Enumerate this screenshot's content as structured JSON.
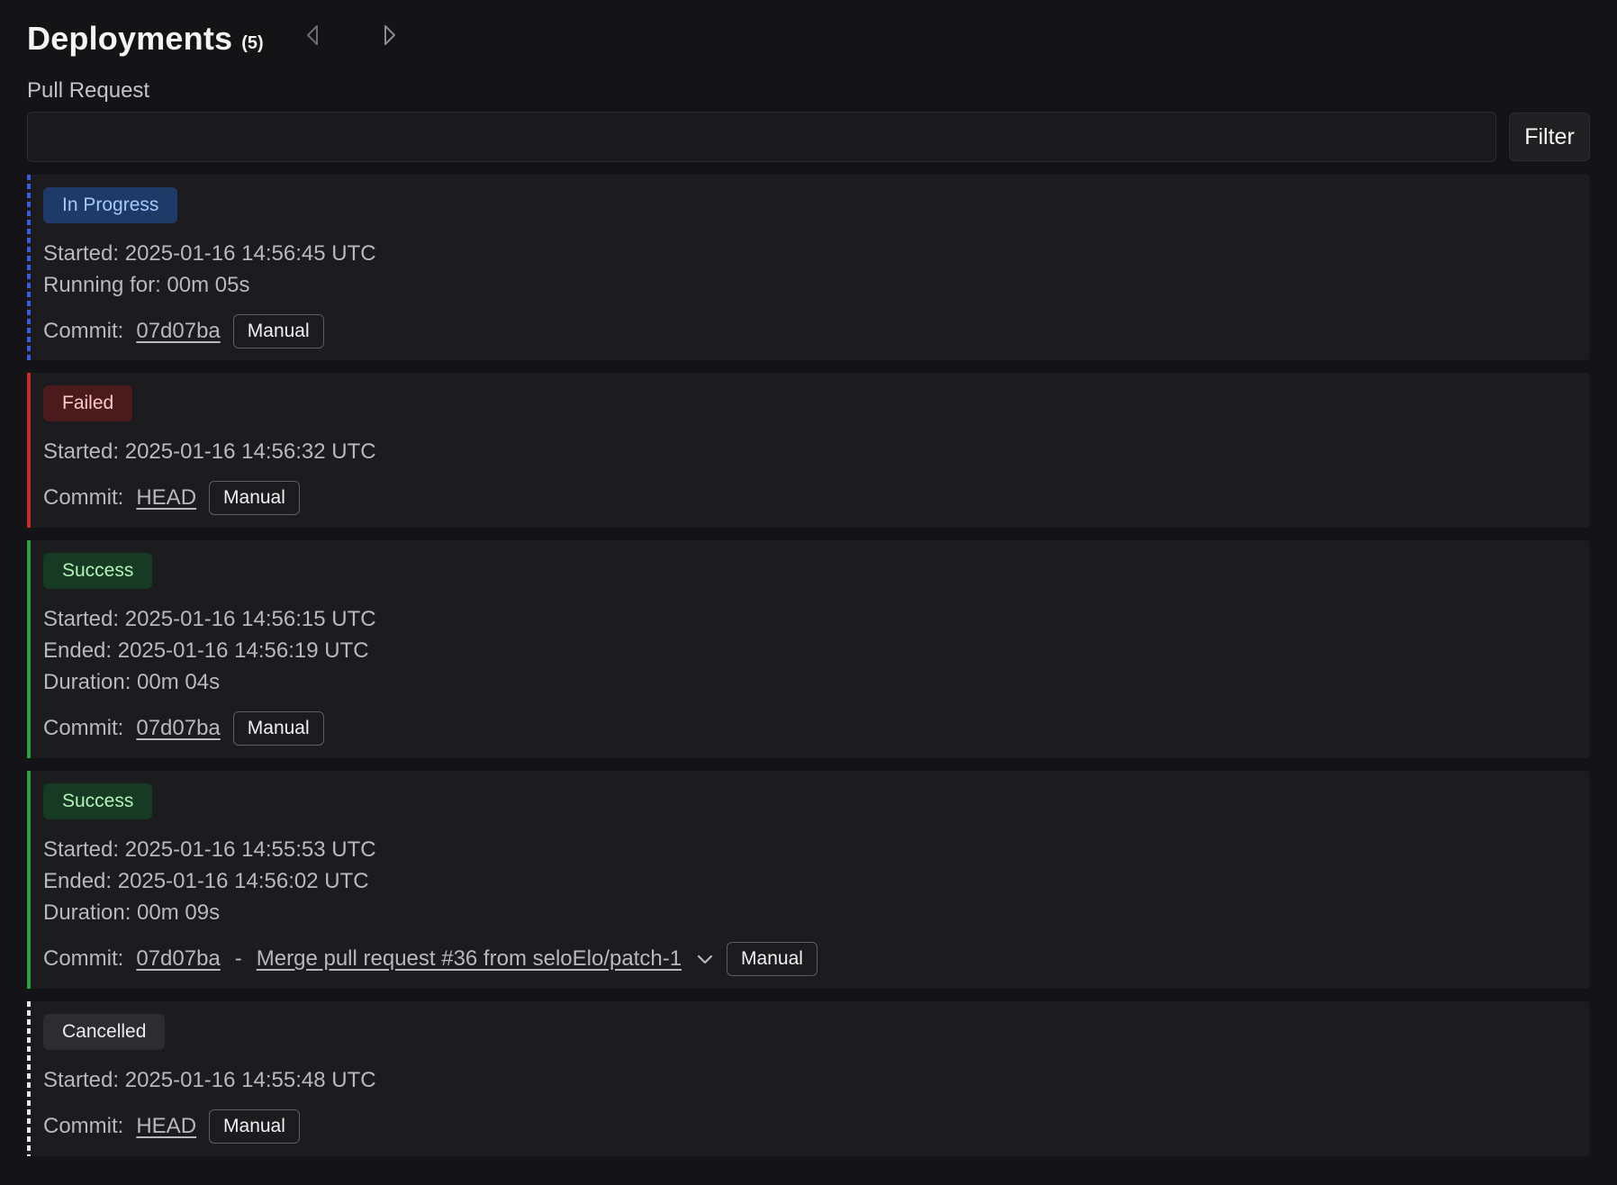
{
  "header": {
    "title": "Deployments",
    "count": "(5)"
  },
  "filter": {
    "label": "Pull Request",
    "value": "",
    "placeholder": "",
    "button_label": "Filter"
  },
  "colors": {
    "in_progress": "#3b5bdb",
    "failed": "#c92a2a",
    "success": "#2f9e44",
    "cancelled": "#e9ecef"
  },
  "deployments": [
    {
      "status": "In Progress",
      "lines": [
        "Started: 2025-01-16 14:56:45 UTC",
        "Running for: 00m 05s"
      ],
      "commit_label": "Commit:",
      "commit": "07d07ba",
      "trigger": "Manual"
    },
    {
      "status": "Failed",
      "lines": [
        "Started: 2025-01-16 14:56:32 UTC"
      ],
      "commit_label": "Commit:",
      "commit": "HEAD",
      "trigger": "Manual"
    },
    {
      "status": "Success",
      "lines": [
        "Started: 2025-01-16 14:56:15 UTC",
        "Ended: 2025-01-16 14:56:19 UTC",
        "Duration: 00m 04s"
      ],
      "commit_label": "Commit:",
      "commit": "07d07ba",
      "trigger": "Manual"
    },
    {
      "status": "Success",
      "lines": [
        "Started: 2025-01-16 14:55:53 UTC",
        "Ended: 2025-01-16 14:56:02 UTC",
        "Duration: 00m 09s"
      ],
      "commit_label": "Commit:",
      "commit": "07d07ba",
      "separator": "-",
      "commit_message": "Merge pull request #36 from seloElo/patch-1",
      "trigger": "Manual"
    },
    {
      "status": "Cancelled",
      "lines": [
        "Started: 2025-01-16 14:55:48 UTC"
      ],
      "commit_label": "Commit:",
      "commit": "HEAD",
      "trigger": "Manual"
    }
  ]
}
